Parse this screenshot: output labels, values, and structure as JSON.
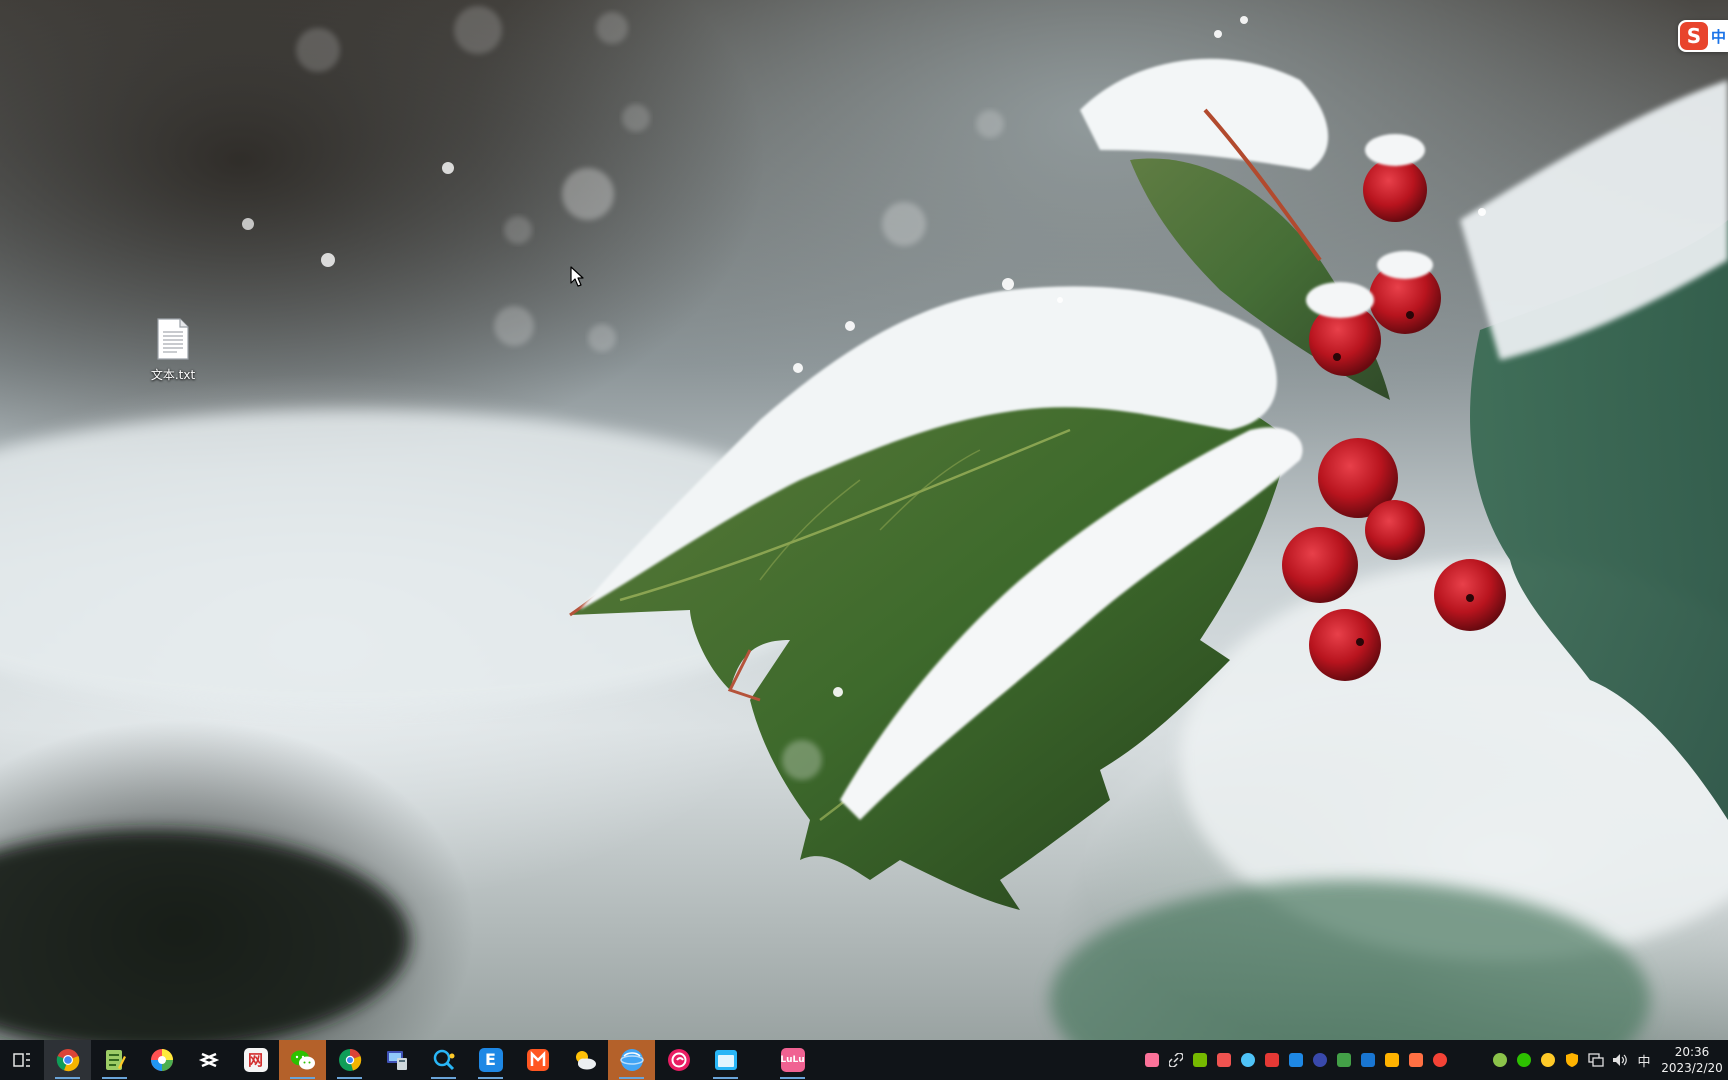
{
  "desktop": {
    "icons": [
      {
        "name": "text-file",
        "label": "文本.txt",
        "icon": "text-file-icon"
      }
    ]
  },
  "ime_badge": {
    "logo_text": "S",
    "mode_text": "中"
  },
  "taskbar": {
    "apps": [
      {
        "id": "task-view",
        "icon": "task-view-icon"
      },
      {
        "id": "chrome",
        "icon": "chrome-icon",
        "active": true
      },
      {
        "id": "notepad-plus",
        "icon": "notepad-icon"
      },
      {
        "id": "color-picker",
        "icon": "color-wheel-icon"
      },
      {
        "id": "capcut",
        "icon": "capcut-icon"
      },
      {
        "id": "netease-news",
        "icon": "news-icon"
      },
      {
        "id": "wechat",
        "icon": "wechat-icon",
        "highlight": true
      },
      {
        "id": "chrome-alt",
        "icon": "chrome-alt-icon"
      },
      {
        "id": "remote-desktop",
        "icon": "remote-icon"
      },
      {
        "id": "search-tool",
        "icon": "search-tool-icon"
      },
      {
        "id": "e-app",
        "icon": "e-app-icon",
        "letter": "E"
      },
      {
        "id": "media-app",
        "icon": "media-icon"
      },
      {
        "id": "weather",
        "icon": "weather-icon"
      },
      {
        "id": "browser-globe",
        "icon": "globe-icon",
        "highlight": true
      },
      {
        "id": "music-app",
        "icon": "music-icon"
      },
      {
        "id": "window-app",
        "icon": "window-icon"
      },
      {
        "id": "bilibili-app",
        "icon": "bilibili-icon",
        "letter": "LuLu"
      }
    ],
    "tray": {
      "ime_indicator": "中",
      "time": "20:36",
      "date": "2023/2/20"
    }
  },
  "colors": {
    "taskbar_bg": "#101418",
    "taskbar_highlight": "#b4612a",
    "running_indicator": "#6aa4d8"
  }
}
